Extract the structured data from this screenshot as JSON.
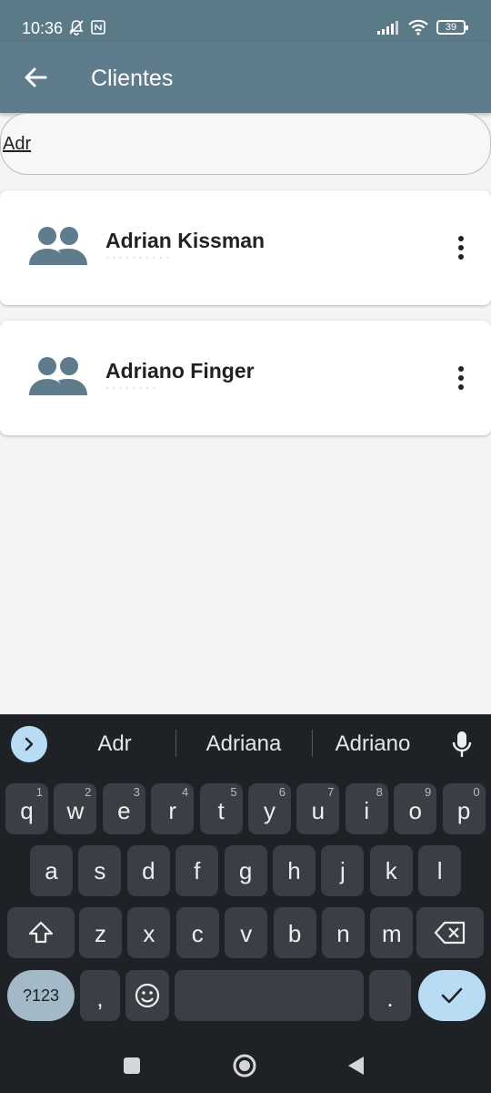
{
  "status": {
    "time": "10:36",
    "battery": "39"
  },
  "appbar": {
    "title": "Clientes"
  },
  "search": {
    "value": "Adr"
  },
  "clients": [
    {
      "name": "Adrian Kissman"
    },
    {
      "name": "Adriano Finger"
    }
  ],
  "keyboard": {
    "suggestions": [
      "Adr",
      "Adriana",
      "Adriano"
    ],
    "row1": [
      {
        "k": "q",
        "h": "1"
      },
      {
        "k": "w",
        "h": "2"
      },
      {
        "k": "e",
        "h": "3"
      },
      {
        "k": "r",
        "h": "4"
      },
      {
        "k": "t",
        "h": "5"
      },
      {
        "k": "y",
        "h": "6"
      },
      {
        "k": "u",
        "h": "7"
      },
      {
        "k": "i",
        "h": "8"
      },
      {
        "k": "o",
        "h": "9"
      },
      {
        "k": "p",
        "h": "0"
      }
    ],
    "row2": [
      "a",
      "s",
      "d",
      "f",
      "g",
      "h",
      "j",
      "k",
      "l"
    ],
    "row3": [
      "z",
      "x",
      "c",
      "v",
      "b",
      "n",
      "m"
    ],
    "symbols_label": "?123",
    "comma": ",",
    "period": "."
  },
  "colors": {
    "primary": "#5e7c8b",
    "accent": "#b9dcf5",
    "keyboard_bg": "#1e2226"
  }
}
